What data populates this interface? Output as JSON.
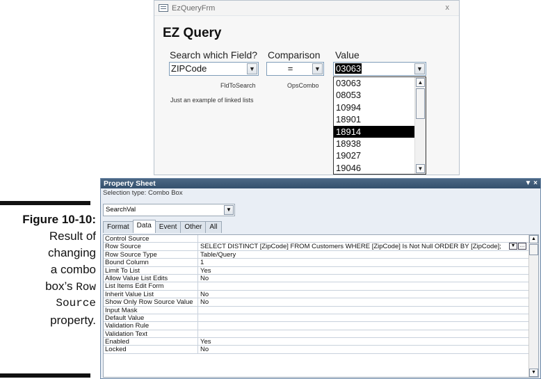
{
  "form": {
    "window_title": "EzQueryFrm",
    "close_glyph": "x",
    "heading": "EZ Query",
    "search_label": "Search which Field?",
    "comparison_label": "Comparison",
    "value_label": "Value",
    "field_combo_value": "ZIPCode",
    "ops_combo_value": "=",
    "value_combo_value": "03063",
    "field_combo_name": "FldToSearch",
    "ops_combo_name": "OpsCombo",
    "note": "Just an example of linked lists",
    "dropdown_items": [
      "03063",
      "08053",
      "10994",
      "18901",
      "18914",
      "18938",
      "19027",
      "19046"
    ],
    "dropdown_selected": "18914"
  },
  "caption": {
    "figure": "Figure 10-10:",
    "line1": "Result of",
    "line2": "changing",
    "line3": "a combo",
    "line4_prefix": "box’s",
    "line4_mono": "Row",
    "line5_mono": "Source",
    "line6": "property."
  },
  "property_sheet": {
    "title": "Property Sheet",
    "controls": "▼ ×",
    "selection_type": "Selection type:  Combo Box",
    "object": "SearchVal",
    "tabs": [
      "Format",
      "Data",
      "Event",
      "Other",
      "All"
    ],
    "active_tab": "Data",
    "rows": [
      {
        "name": "Control Source",
        "value": ""
      },
      {
        "name": "Row Source",
        "value": "SELECT DISTINCT [ZipCode] FROM Customers WHERE [ZipCode] Is Not Null ORDER BY [ZipCode];"
      },
      {
        "name": "Row Source Type",
        "value": "Table/Query"
      },
      {
        "name": "Bound Column",
        "value": "1"
      },
      {
        "name": "Limit To List",
        "value": "Yes"
      },
      {
        "name": "Allow Value List Edits",
        "value": "No"
      },
      {
        "name": "List Items Edit Form",
        "value": ""
      },
      {
        "name": "Inherit Value List",
        "value": "No"
      },
      {
        "name": "Show Only Row Source Value",
        "value": "No"
      },
      {
        "name": "Input Mask",
        "value": ""
      },
      {
        "name": "Default Value",
        "value": ""
      },
      {
        "name": "Validation Rule",
        "value": ""
      },
      {
        "name": "Validation Text",
        "value": ""
      },
      {
        "name": "Enabled",
        "value": "Yes"
      },
      {
        "name": "Locked",
        "value": "No"
      }
    ]
  }
}
